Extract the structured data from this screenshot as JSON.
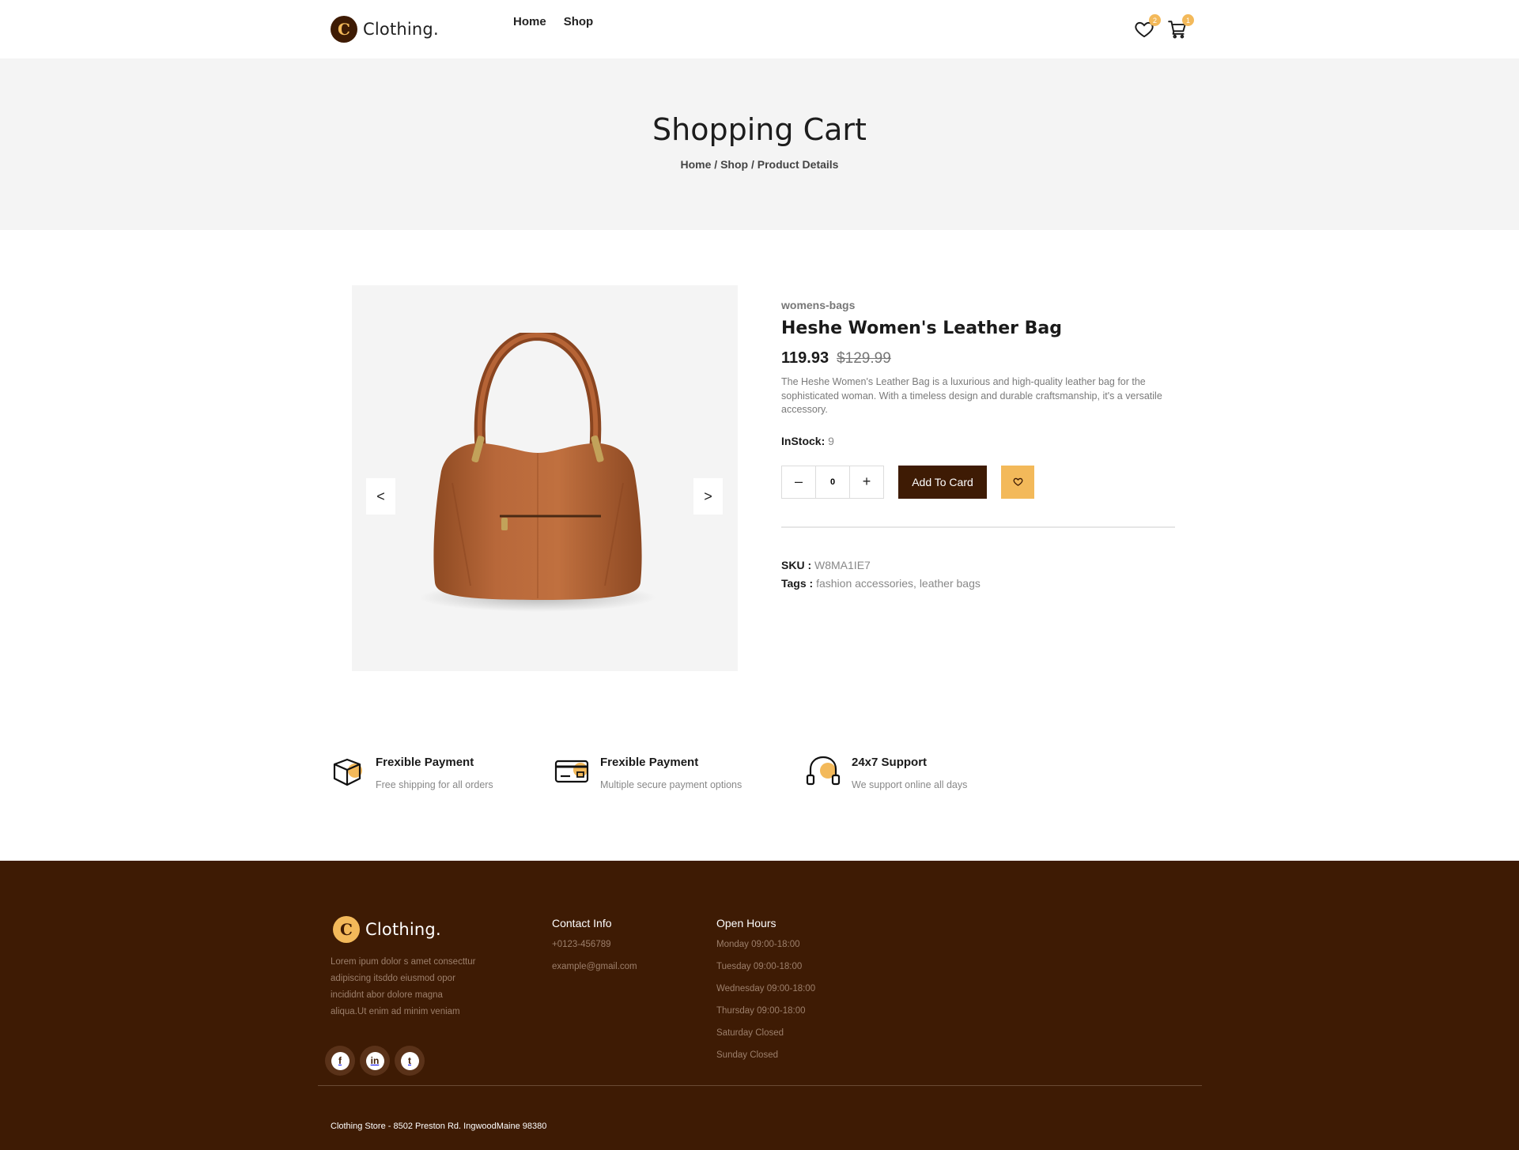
{
  "brand": {
    "logo_letter": "C",
    "name": "Clothing."
  },
  "nav": {
    "home": "Home",
    "shop": "Shop"
  },
  "header_icons": {
    "wishlist_icon": "heart-icon",
    "wishlist_count": "2",
    "cart_icon": "cart-icon",
    "cart_count": "1"
  },
  "hero": {
    "title": "Shopping Cart",
    "breadcrumb": [
      "Home",
      "Shop",
      "Product Details"
    ],
    "separator": " / "
  },
  "gallery": {
    "prev": "<",
    "next": ">"
  },
  "product": {
    "category": "womens-bags",
    "title": "Heshe Women's Leather Bag",
    "price": "119.93",
    "old_price": "$129.99",
    "description": "The Heshe Women's Leather Bag is a luxurious and high-quality leather bag for the sophisticated woman. With a timeless design and durable craftsmanship, it's a versatile accessory.",
    "stock_label": "InStock:",
    "stock_value": "9",
    "qty_minus": "–",
    "qty_value": "0",
    "qty_plus": "+",
    "add_label": "Add To Card",
    "sku_label": "SKU :",
    "sku_value": "W8MA1IE7",
    "tags_label": "Tags :",
    "tags_value": "fashion accessories, leather bags"
  },
  "features": [
    {
      "icon": "box-icon",
      "title": "Frexible Payment",
      "subtitle": "Free shipping for all orders"
    },
    {
      "icon": "credit-card-icon",
      "title": "Frexible Payment",
      "subtitle": "Multiple secure payment options"
    },
    {
      "icon": "headset-icon",
      "title": "24x7 Support",
      "subtitle": "We support online all days"
    }
  ],
  "footer": {
    "about": "Lorem ipum dolor s amet consecttur adipiscing itsddo eiusmod opor incididnt abor dolore magna aliqua.Ut enim ad minim veniam",
    "socials": [
      {
        "icon": "facebook-icon",
        "glyph": "f"
      },
      {
        "icon": "linkedin-icon",
        "glyph": "in"
      },
      {
        "icon": "tumblr-icon",
        "glyph": "t"
      }
    ],
    "contact_title": "Contact Info",
    "contact": [
      "+0123-456789",
      "example@gmail.com"
    ],
    "hours_title": "Open Hours",
    "hours": [
      "Monday 09:00-18:00",
      "Tuesday 09:00-18:00",
      "Wednesday 09:00-18:00",
      "Thursday 09:00-18:00",
      "Saturday Closed",
      "Sunday Closed"
    ],
    "address": "Clothing Store - 8502 Preston Rd. IngwoodMaine 98380"
  },
  "colors": {
    "brand_dark": "#3e1b04",
    "accent": "#f3b95a",
    "hero_bg": "#f4f4f4"
  }
}
